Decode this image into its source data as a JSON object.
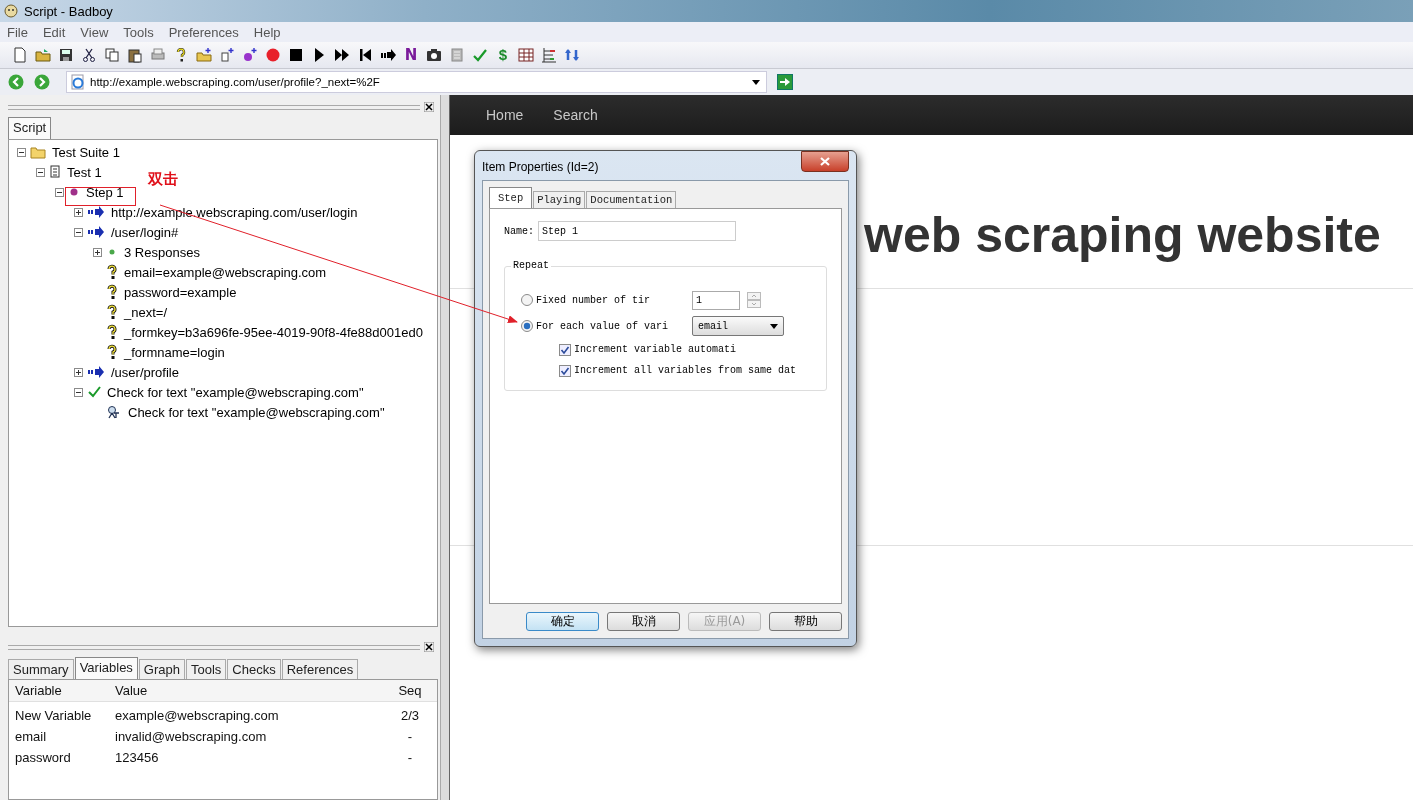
{
  "window": {
    "title": "Script - Badboy"
  },
  "menu": [
    "File",
    "Edit",
    "View",
    "Tools",
    "Preferences",
    "Help"
  ],
  "toolbar_glyphs": [
    "N",
    "$"
  ],
  "address": {
    "url": "http://example.webscraping.com/user/profile?_next=%2F"
  },
  "script_panel": {
    "tabs": [
      {
        "label": "Script",
        "selected": true
      }
    ],
    "tree": [
      {
        "label": "Test Suite 1",
        "kind": "suite",
        "expanded": true,
        "children": [
          {
            "label": "Test 1",
            "kind": "test",
            "expanded": true,
            "children": [
              {
                "label": "Step 1",
                "kind": "step",
                "expanded": true,
                "children": [
                  {
                    "label": "http://example.webscraping.com/user/login",
                    "kind": "request",
                    "expanded": false
                  },
                  {
                    "label": "/user/login#",
                    "kind": "request",
                    "expanded": true,
                    "children": [
                      {
                        "label": "3 Responses",
                        "kind": "responses",
                        "expanded": false
                      },
                      {
                        "label": "email=example@webscraping.com",
                        "kind": "param"
                      },
                      {
                        "label": "password=example",
                        "kind": "param"
                      },
                      {
                        "label": "_next=/",
                        "kind": "param"
                      },
                      {
                        "label": "_formkey=b3a696fe-95ee-4019-90f8-4fe88d001ed0",
                        "kind": "param"
                      },
                      {
                        "label": "_formname=login",
                        "kind": "param"
                      }
                    ]
                  },
                  {
                    "label": "/user/profile",
                    "kind": "request",
                    "expanded": false
                  },
                  {
                    "label": "Check for text \"example@webscraping.com\"",
                    "kind": "check",
                    "expanded": true,
                    "children": [
                      {
                        "label": "Check for text \"example@webscraping.com\"",
                        "kind": "check-item"
                      }
                    ]
                  }
                ]
              }
            ]
          }
        ]
      }
    ]
  },
  "bottom_panel": {
    "tabs": [
      {
        "label": "Summary",
        "selected": false
      },
      {
        "label": "Variables",
        "selected": true
      },
      {
        "label": "Graph",
        "selected": false
      },
      {
        "label": "Tools",
        "selected": false
      },
      {
        "label": "Checks",
        "selected": false
      },
      {
        "label": "References",
        "selected": false
      }
    ],
    "table": {
      "columns": [
        "Variable",
        "Value",
        "Seq"
      ],
      "rows": [
        [
          "New Variable",
          "example@webscraping.com",
          "2/3"
        ],
        [
          "email",
          "invalid@webscraping.com",
          "-"
        ],
        [
          "password",
          "123456",
          "-"
        ]
      ]
    }
  },
  "browser": {
    "nav": [
      "Home",
      "Search"
    ],
    "heading": "web scraping website"
  },
  "dialog": {
    "title": "Item Properties (Id=2)",
    "tabs": [
      {
        "label": "Step",
        "selected": true
      },
      {
        "label": "Playing",
        "selected": false
      },
      {
        "label": "Documentation",
        "selected": false
      }
    ],
    "name_label": "Name:",
    "name_value": "Step 1",
    "group": "Repeat",
    "radios": [
      {
        "label": "Fixed number of tir",
        "selected": false,
        "kind": "spin",
        "value": "1"
      },
      {
        "label": "For each value of vari",
        "selected": true,
        "kind": "dropdown",
        "value": "email"
      }
    ],
    "checkboxes": [
      {
        "label": "Increment variable automati",
        "checked": true
      },
      {
        "label": "Increment all variables from same dat",
        "checked": true
      }
    ],
    "buttons": [
      {
        "label": "确定",
        "disabled": false,
        "default": true
      },
      {
        "label": "取消",
        "disabled": false,
        "default": false
      },
      {
        "label": "应用(A)",
        "disabled": true,
        "default": false
      },
      {
        "label": "帮助",
        "disabled": false,
        "default": false
      }
    ]
  },
  "annotation": {
    "label": "双击"
  }
}
